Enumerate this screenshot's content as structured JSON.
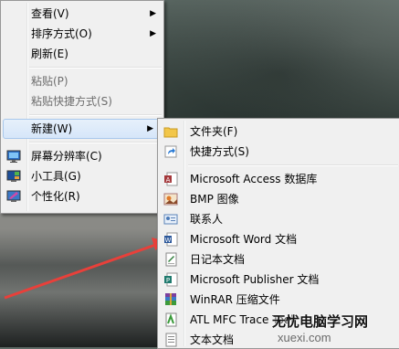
{
  "context_menu": {
    "items": [
      {
        "label": "查看(V)",
        "submenu": true
      },
      {
        "label": "排序方式(O)",
        "submenu": true
      },
      {
        "label": "刷新(E)"
      },
      {
        "label": "粘贴(P)",
        "disabled": true
      },
      {
        "label": "粘贴快捷方式(S)",
        "disabled": true
      },
      {
        "label": "新建(W)",
        "submenu": true,
        "active": true
      },
      {
        "label": "屏幕分辨率(C)",
        "icon": "monitor-icon"
      },
      {
        "label": "小工具(G)",
        "icon": "gadgets-icon"
      },
      {
        "label": "个性化(R)",
        "icon": "personalize-icon"
      }
    ]
  },
  "new_submenu": {
    "items": [
      {
        "label": "文件夹(F)",
        "icon": "folder-icon"
      },
      {
        "label": "快捷方式(S)",
        "icon": "shortcut-icon"
      },
      {
        "label": "Microsoft Access 数据库",
        "icon": "access-icon"
      },
      {
        "label": "BMP 图像",
        "icon": "bmp-icon"
      },
      {
        "label": "联系人",
        "icon": "contact-icon"
      },
      {
        "label": "Microsoft Word 文档",
        "icon": "word-icon"
      },
      {
        "label": "日记本文档",
        "icon": "journal-icon"
      },
      {
        "label": "Microsoft Publisher 文档",
        "icon": "publisher-icon"
      },
      {
        "label": "WinRAR 压缩文件",
        "icon": "winrar-icon"
      },
      {
        "label": "ATL MFC Trace Tool",
        "icon": "trace-tool-icon"
      },
      {
        "label": "文本文档",
        "icon": "text-doc-icon"
      }
    ]
  },
  "watermark": {
    "line1": "无忧电脑学习网",
    "line2": "xuexi.com"
  },
  "colors": {
    "annotation_arrow": "#e8403a"
  }
}
